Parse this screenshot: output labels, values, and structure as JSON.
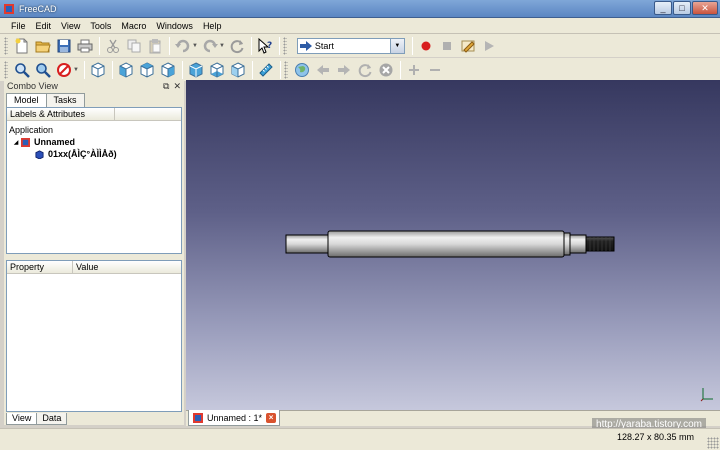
{
  "window": {
    "title": "FreeCAD"
  },
  "menu": [
    "File",
    "Edit",
    "View",
    "Tools",
    "Macro",
    "Windows",
    "Help"
  ],
  "macro_toolbar": {
    "selected": "Start"
  },
  "combo_view": {
    "title": "Combo View",
    "tabs": [
      "Model",
      "Tasks"
    ],
    "tree_header": "Labels & Attributes",
    "tree": {
      "root": "Application",
      "document": "Unnamed",
      "object": "01xx(ÅÌÇ°ÀÌÌÅð)"
    },
    "property_headers": [
      "Property",
      "Value"
    ],
    "bottom_tabs": [
      "View",
      "Data"
    ]
  },
  "document_tab": {
    "label": "Unnamed : 1*"
  },
  "status": {
    "dimensions": "128.27 x 80.35 mm"
  },
  "watermark": "http://yaraba.tistory.com",
  "colors": {
    "title_bar": "#5b86c2",
    "viewport_top": "#36385f",
    "viewport_bottom": "#c6c8dc",
    "record_red": "#d81e1e"
  }
}
